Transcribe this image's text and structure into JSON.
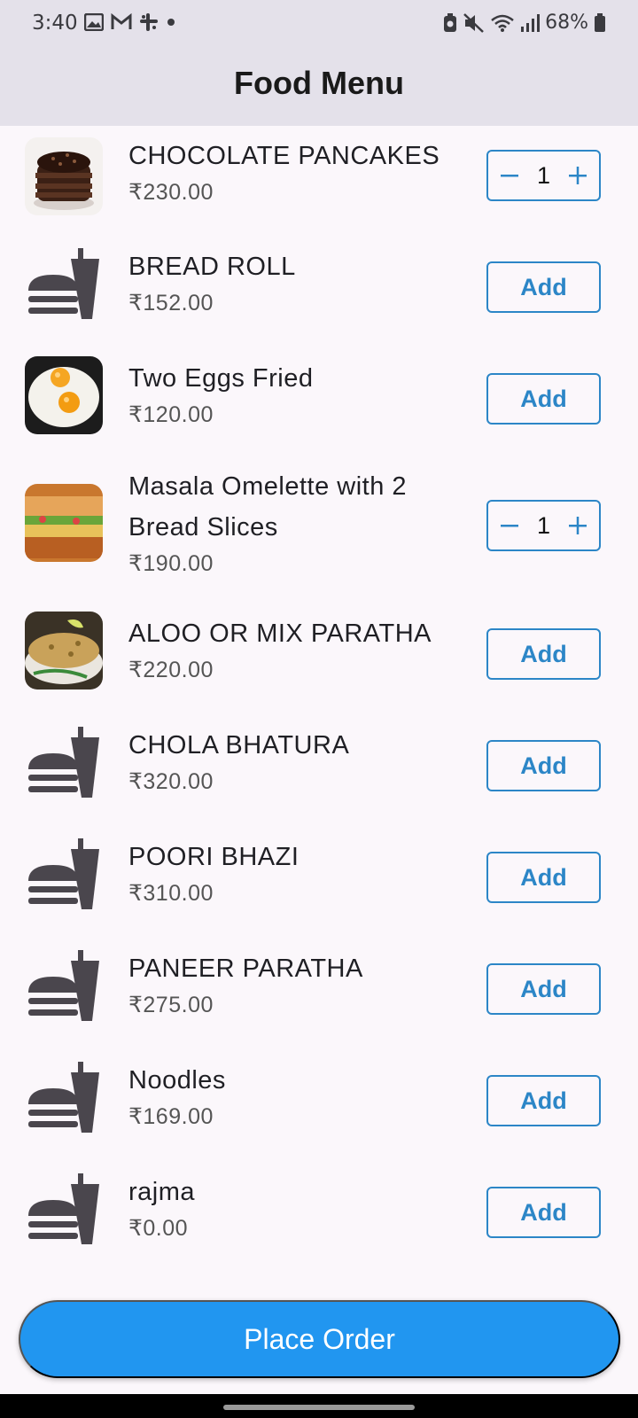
{
  "status_bar": {
    "time": "3:40",
    "battery": "68%",
    "left_icons": [
      "gallery-icon",
      "gmail-icon",
      "slack-icon",
      "dot-icon"
    ],
    "right_icons": [
      "battery-saver-icon",
      "mute-icon",
      "wifi-icon",
      "signal-icon",
      "battery-icon"
    ]
  },
  "app_bar": {
    "title": "Food Menu"
  },
  "items": [
    {
      "name": "CHOCOLATE PANCAKES",
      "price": "₹230.00",
      "image": "chocolate-pancakes-photo",
      "quantity": "1"
    },
    {
      "name": "BREAD ROLL",
      "price": "₹152.00",
      "image": "fastfood-icon",
      "button": "Add"
    },
    {
      "name": "Two Eggs Fried",
      "price": "₹120.00",
      "image": "fried-eggs-photo",
      "button": "Add"
    },
    {
      "name": "Masala Omelette with 2 Bread Slices",
      "price": "₹190.00",
      "image": "omelette-sandwich-photo",
      "quantity": "1"
    },
    {
      "name": "ALOO OR MIX PARATHA",
      "price": "₹220.00",
      "image": "paratha-photo",
      "button": "Add"
    },
    {
      "name": "CHOLA BHATURA",
      "price": "₹320.00",
      "image": "fastfood-icon",
      "button": "Add"
    },
    {
      "name": "POORI BHAZI",
      "price": "₹310.00",
      "image": "fastfood-icon",
      "button": "Add"
    },
    {
      "name": "PANEER PARATHA",
      "price": "₹275.00",
      "image": "fastfood-icon",
      "button": "Add"
    },
    {
      "name": "Noodles",
      "price": "₹169.00",
      "image": "fastfood-icon",
      "button": "Add"
    },
    {
      "name": "rajma",
      "price": "₹0.00",
      "image": "fastfood-icon",
      "button": "Add"
    }
  ],
  "footer": {
    "place_order": "Place Order"
  },
  "colors": {
    "accent": "#2c86c7",
    "primary_button": "#2196f0",
    "app_bar": "#e4e1ea",
    "background": "#fbf7fb"
  }
}
